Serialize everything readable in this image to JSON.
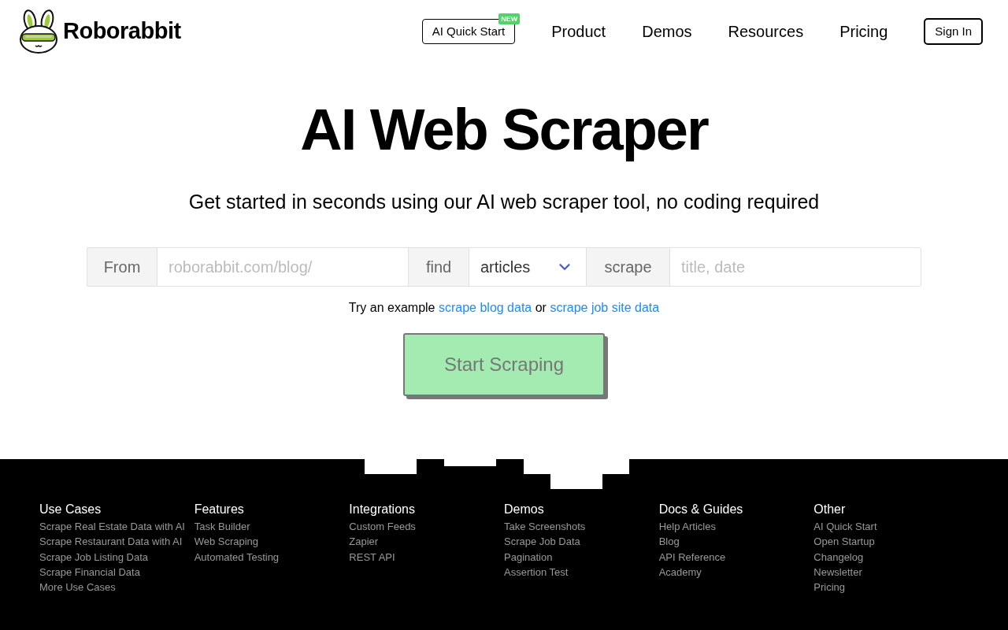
{
  "header": {
    "logo": {
      "text": "Roborabbit"
    },
    "nav": [
      {
        "kind": "outlined",
        "label": "AI Quick Start",
        "badge": "NEW"
      },
      {
        "kind": "link",
        "label": "Product"
      },
      {
        "kind": "link",
        "label": "Demos"
      },
      {
        "kind": "link",
        "label": "Resources"
      },
      {
        "kind": "link",
        "label": "Pricing"
      },
      {
        "kind": "button",
        "label": "Sign In"
      }
    ]
  },
  "hero": {
    "title": "AI Web Scraper",
    "subtitle": "Get started in seconds using our AI web scraper tool, no coding required"
  },
  "form": {
    "segments": [
      {
        "kind": "label",
        "text": "From"
      },
      {
        "kind": "input",
        "placeholder": "roborabbit.com/blog/"
      },
      {
        "kind": "label",
        "text": "find"
      },
      {
        "kind": "select",
        "value": "articles"
      },
      {
        "kind": "label",
        "text": "scrape"
      },
      {
        "kind": "input",
        "placeholder": "title, date"
      }
    ]
  },
  "examples": {
    "lead": "Try an example",
    "links": [
      "scrape blog data",
      "scrape job site data"
    ],
    "joiner": "or"
  },
  "cta": {
    "label": "Start Scraping",
    "disabled": true
  },
  "footer": {
    "columns": [
      {
        "heading": "Use Cases",
        "links": [
          "Scrape Real Estate Data with AI",
          "Scrape Restaurant Data with AI",
          "Scrape Job Listing Data",
          "Scrape Financial Data",
          "More Use Cases"
        ]
      },
      {
        "heading": "Features",
        "links": [
          "Task Builder",
          "Web Scraping",
          "Automated Testing"
        ]
      },
      {
        "heading": "Integrations",
        "links": [
          "Custom Feeds",
          "Zapier",
          "REST API"
        ]
      },
      {
        "heading": "Demos",
        "links": [
          "Take Screenshots",
          "Scrape Job Data",
          "Pagination",
          "Assertion Test"
        ]
      },
      {
        "heading": "Docs & Guides",
        "links": [
          "Help Articles",
          "Blog",
          "API Reference",
          "Academy"
        ]
      },
      {
        "heading": "Other",
        "links": [
          "AI Quick Start",
          "Open Startup",
          "Changelog",
          "Newsletter",
          "Pricing"
        ]
      }
    ]
  }
}
